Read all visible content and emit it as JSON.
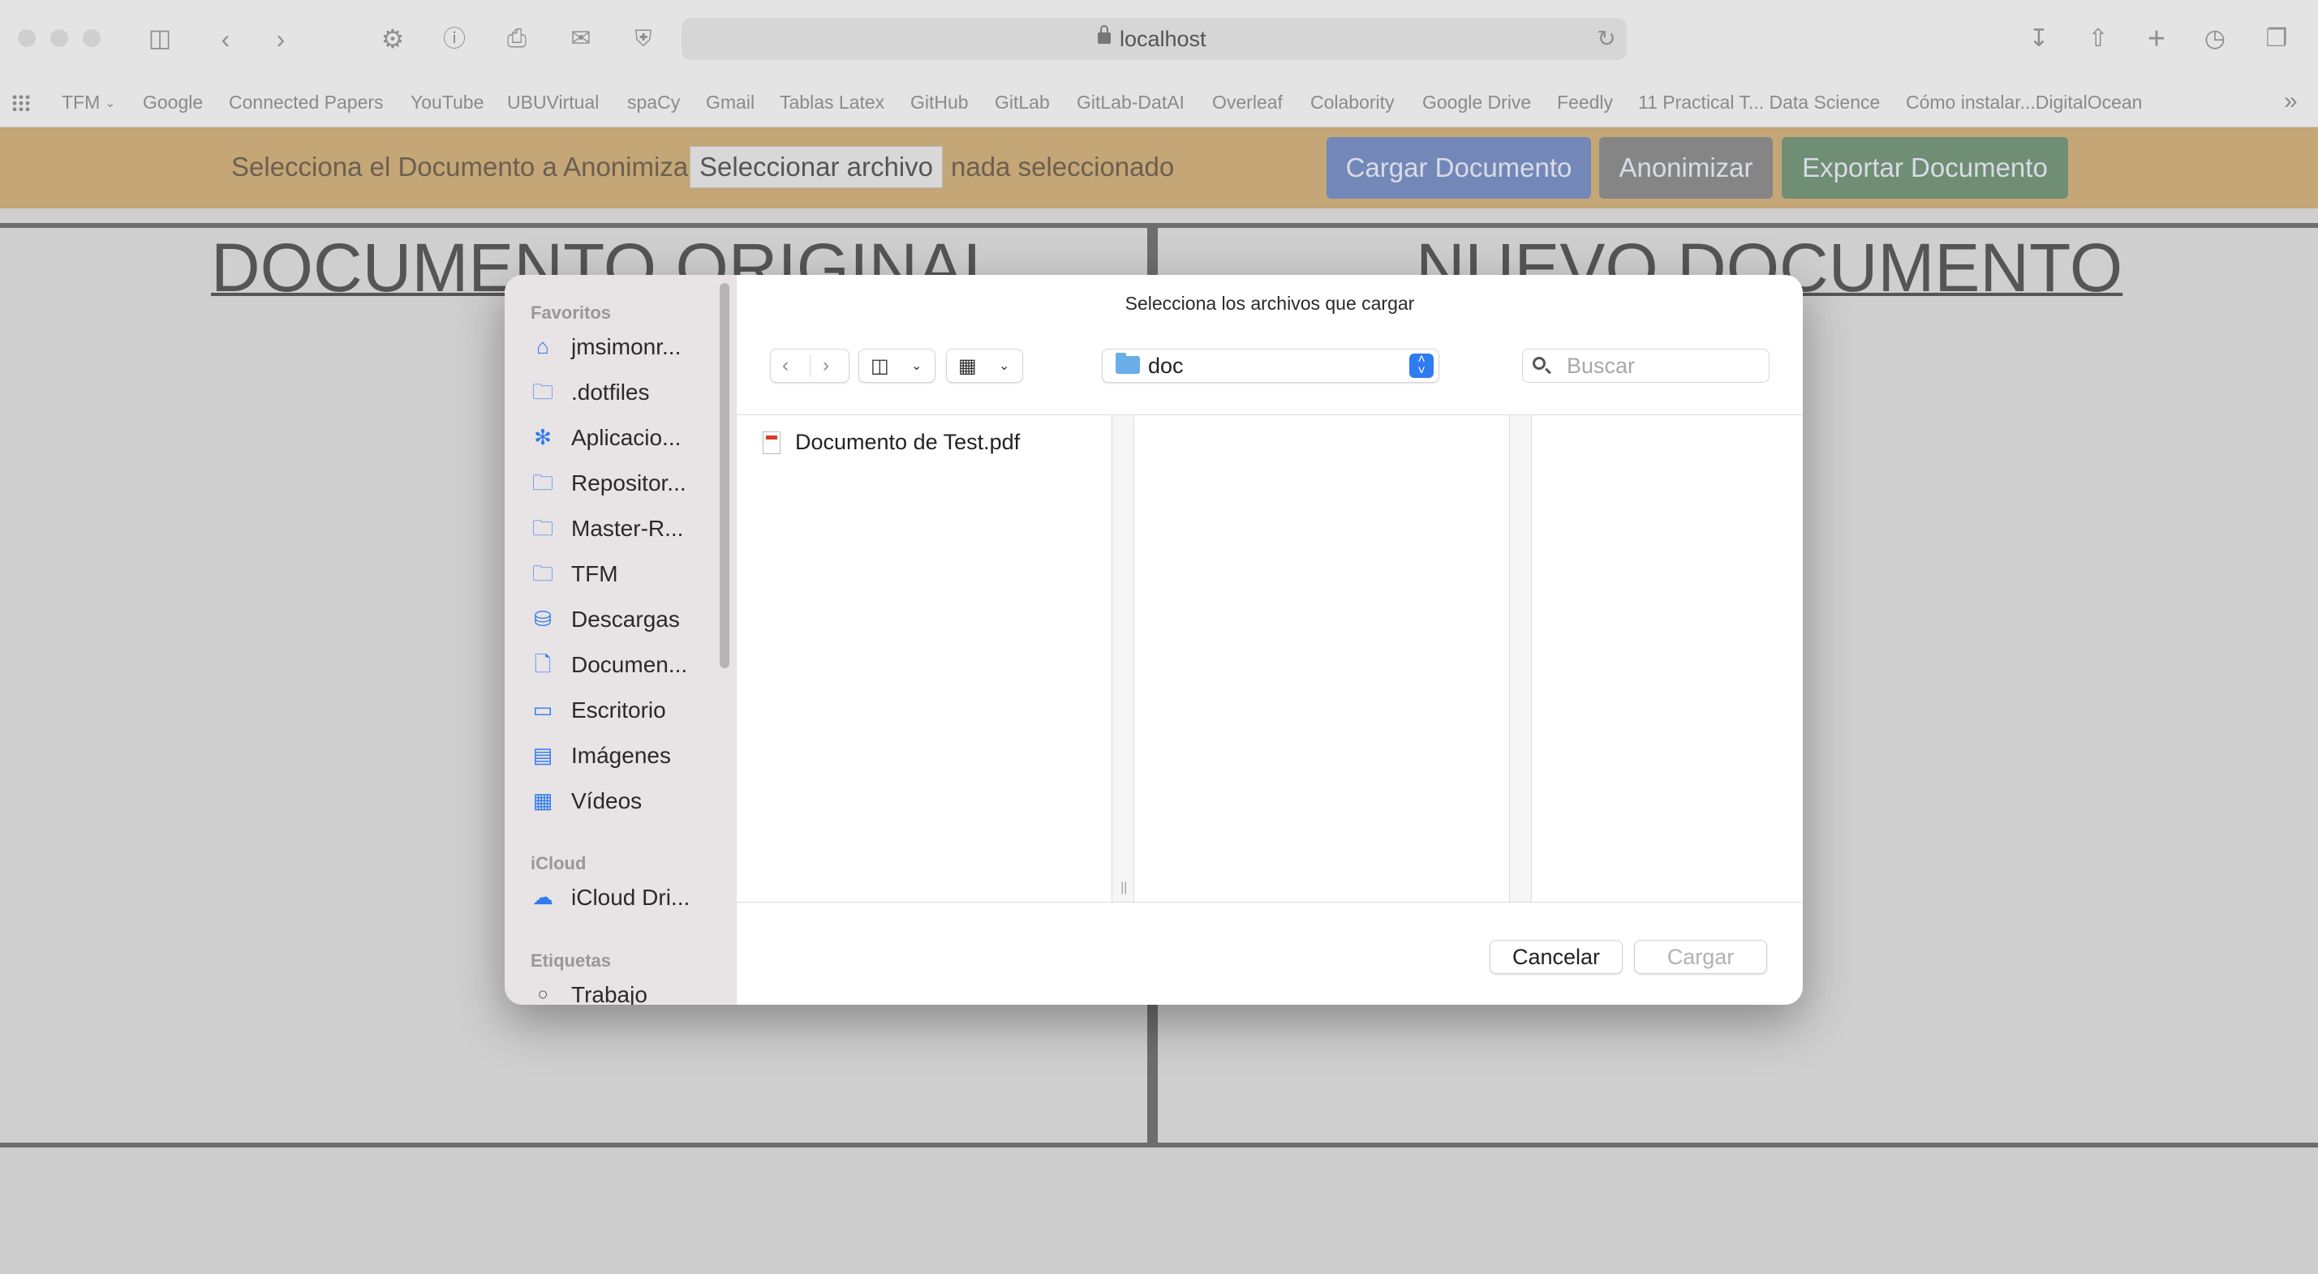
{
  "browser": {
    "url": "localhost",
    "bookmarks": [
      "TFM",
      "Google",
      "Connected Papers",
      "YouTube",
      "UBUVirtual",
      "spaCy",
      "Gmail",
      "Tablas Latex",
      "GitHub",
      "GitLab",
      "GitLab-DatAI",
      "Overleaf",
      "Colabority",
      "Google Drive",
      "Feedly",
      "11 Practical T... Data Science",
      "Cómo instalar...DigitalOcean"
    ]
  },
  "page": {
    "select_label": "Selecciona el Documento a Anonimizar",
    "file_button": "Seleccionar archivo",
    "file_status": "nada seleccionado",
    "buttons": {
      "load": "Cargar Documento",
      "anonymize": "Anonimizar",
      "export": "Exportar Documento"
    },
    "left_heading": "DOCUMENTO ORIGINAL",
    "right_heading": "NUEVO DOCUMENTO"
  },
  "dialog": {
    "title": "Selecciona los archivos que cargar",
    "folder": "doc",
    "search_placeholder": "Buscar",
    "sidebar": {
      "favorites_header": "Favoritos",
      "favorites": [
        {
          "label": "jmsimonr...",
          "icon": "home-icon"
        },
        {
          "label": ".dotfiles",
          "icon": "folder-icon"
        },
        {
          "label": "Aplicacio...",
          "icon": "applications-icon"
        },
        {
          "label": "Repositor...",
          "icon": "folder-icon"
        },
        {
          "label": "Master-R...",
          "icon": "folder-icon"
        },
        {
          "label": "TFM",
          "icon": "folder-icon"
        },
        {
          "label": "Descargas",
          "icon": "download-icon"
        },
        {
          "label": "Documen...",
          "icon": "document-icon"
        },
        {
          "label": "Escritorio",
          "icon": "desktop-icon"
        },
        {
          "label": "Imágenes",
          "icon": "photo-icon"
        },
        {
          "label": "Vídeos",
          "icon": "film-icon"
        }
      ],
      "icloud_header": "iCloud",
      "icloud": [
        {
          "label": "iCloud Dri...",
          "icon": "cloud-icon"
        }
      ],
      "tags_header": "Etiquetas",
      "tags": [
        {
          "label": "Trabajo",
          "icon": "tag-circle-icon"
        }
      ]
    },
    "files": [
      {
        "name": "Documento de Test.pdf",
        "icon": "pdf-icon"
      }
    ],
    "cancel": "Cancelar",
    "load": "Cargar"
  },
  "colors": {
    "orange_bar": "#c4a677",
    "load_button": "#7388b8",
    "anonymize_button": "#858585",
    "export_button": "#6f8e74",
    "accent": "#2f7bf0"
  }
}
